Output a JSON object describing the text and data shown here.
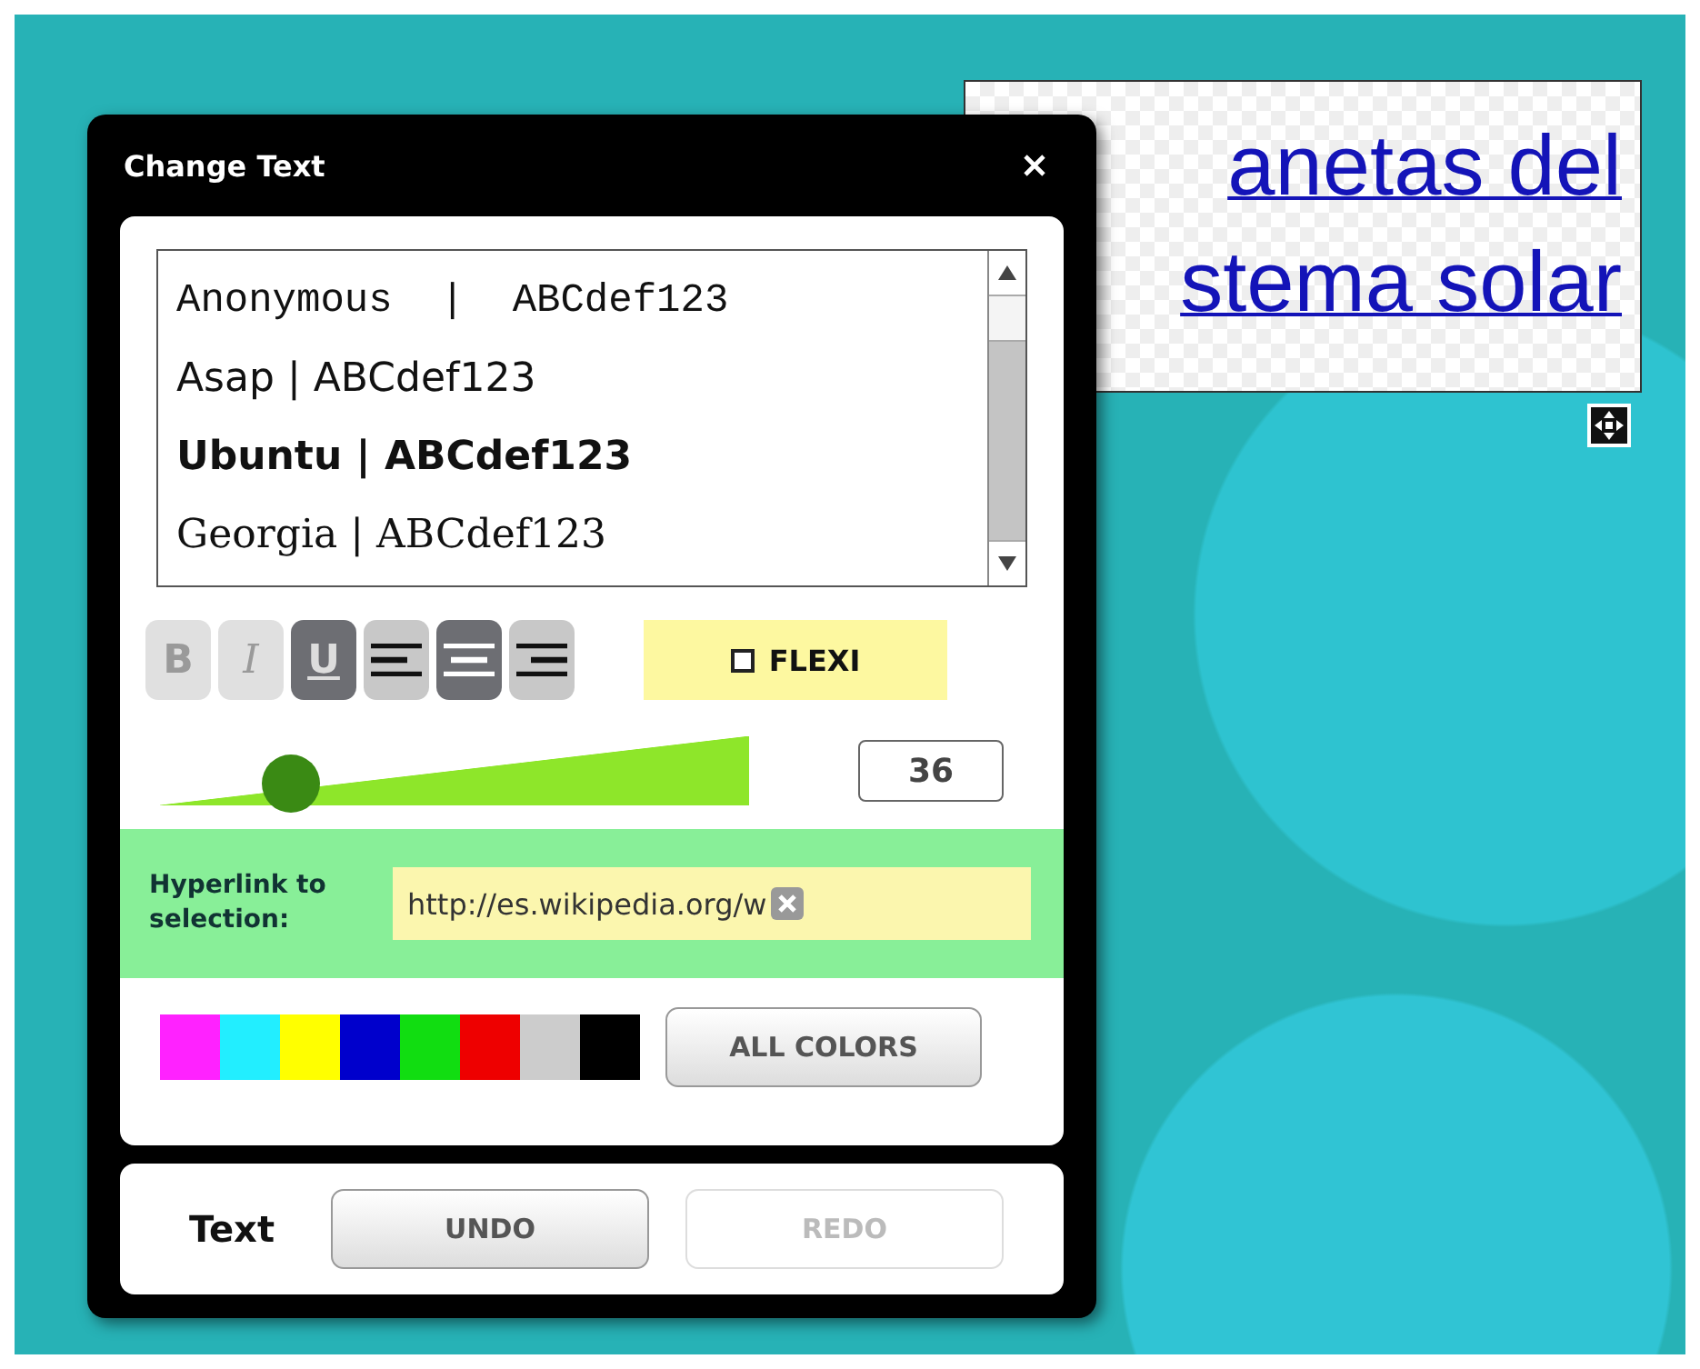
{
  "canvas": {
    "text_box": {
      "lines": [
        "anetas del",
        "stema solar"
      ]
    }
  },
  "dialog": {
    "title": "Change Text",
    "fonts": [
      {
        "label": "Anonymous  |  ABCdef123",
        "kind": "mono"
      },
      {
        "label": "Asap | ABCdef123",
        "kind": "sans"
      },
      {
        "label": "Ubuntu | ABCdef123",
        "kind": "sans-bold"
      },
      {
        "label": "Georgia | ABCdef123",
        "kind": "serif"
      }
    ],
    "format_buttons": [
      {
        "kind": "bold",
        "label": "B",
        "selected": false
      },
      {
        "kind": "italic",
        "label": "I",
        "selected": false
      },
      {
        "kind": "underline",
        "label": "U",
        "selected": true
      },
      {
        "kind": "align-left",
        "selected": false
      },
      {
        "kind": "align-center",
        "selected": true
      },
      {
        "kind": "align-right",
        "selected": false
      }
    ],
    "flexi": {
      "label": "FLEXI",
      "checked": false
    },
    "size_slider": {
      "level": 0.18
    },
    "size_value": "36",
    "hyperlink": {
      "label": "Hyperlink to selection:",
      "value": "http://es.wikipedia.org/w"
    },
    "swatches": [
      {
        "color": "#ff22ff"
      },
      {
        "color": "#22eeff"
      },
      {
        "color": "#ffff00"
      },
      {
        "color": "#0000cc"
      },
      {
        "color": "#11dd11"
      },
      {
        "color": "#ee0000"
      },
      {
        "color": "#cccccc"
      },
      {
        "color": "#000000"
      }
    ],
    "all_colors": "ALL COLORS",
    "footer": {
      "label": "Text",
      "undo": {
        "label": "UNDO",
        "disabled": false
      },
      "redo": {
        "label": "REDO",
        "disabled": true
      }
    }
  }
}
